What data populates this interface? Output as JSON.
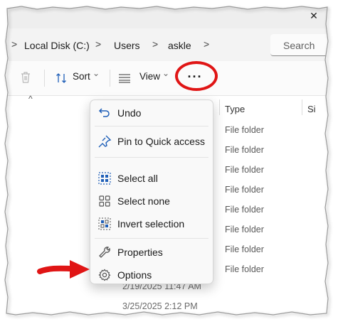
{
  "window": {
    "close_glyph": "✕"
  },
  "breadcrumb": {
    "items": [
      "Local Disk (C:)",
      "Users",
      "askle"
    ],
    "separator": ">"
  },
  "search": {
    "placeholder": "Search"
  },
  "toolbar": {
    "sort_label": "Sort",
    "view_label": "View",
    "more_label": "···",
    "dropdown_glyph": "⌄"
  },
  "columns": {
    "type": "Type",
    "size": "Si"
  },
  "rows": {
    "types": [
      "File folder",
      "File folder",
      "File folder",
      "File folder",
      "File folder",
      "File folder",
      "File folder",
      "File folder"
    ],
    "dates": [
      "2/19/2025 11:47 AM",
      "3/25/2025 2:12 PM"
    ]
  },
  "menu": {
    "items": [
      "Undo",
      "Pin to Quick access",
      "Select all",
      "Select none",
      "Invert selection",
      "Properties",
      "Options"
    ]
  },
  "icons": [
    "trash-icon",
    "sort-icon",
    "view-icon",
    "more-icon",
    "undo-icon",
    "pin-icon",
    "select-all-icon",
    "select-none-icon",
    "invert-selection-icon",
    "properties-icon",
    "options-icon",
    "red-arrow"
  ],
  "colors": {
    "highlight_red": "#e01515",
    "icon_blue": "#1f5fb8"
  }
}
